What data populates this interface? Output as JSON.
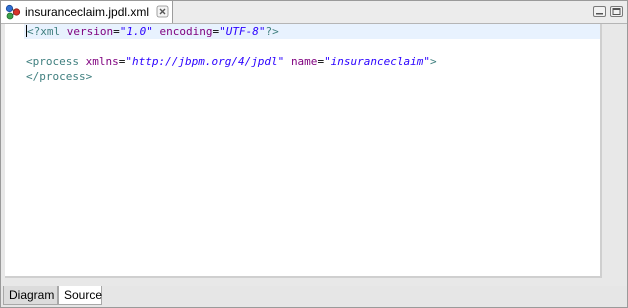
{
  "editor": {
    "tab_title": "insuranceclaim.jpdl.xml",
    "tab_icon": "jpdl-file-icon",
    "close_icon": "close-icon"
  },
  "source": {
    "lines": [
      {
        "parts": [
          {
            "t": "<?xml ",
            "c": "tag"
          },
          {
            "t": "version",
            "c": "attr"
          },
          {
            "t": "=",
            "c": "eq"
          },
          {
            "t": "\"1.0\"",
            "c": "val"
          },
          {
            "t": " ",
            "c": "eq"
          },
          {
            "t": "encoding",
            "c": "attr"
          },
          {
            "t": "=",
            "c": "eq"
          },
          {
            "t": "\"UTF-8\"",
            "c": "val"
          },
          {
            "t": "?>",
            "c": "tag"
          }
        ],
        "current": true
      },
      {
        "parts": [],
        "current": false
      },
      {
        "parts": [
          {
            "t": "<process ",
            "c": "tag"
          },
          {
            "t": "xmlns",
            "c": "attr"
          },
          {
            "t": "=",
            "c": "eq"
          },
          {
            "t": "\"http://jbpm.org/4/jpdl\"",
            "c": "val"
          },
          {
            "t": " ",
            "c": "eq"
          },
          {
            "t": "name",
            "c": "attr"
          },
          {
            "t": "=",
            "c": "eq"
          },
          {
            "t": "\"insuranceclaim\"",
            "c": "val"
          },
          {
            "t": ">",
            "c": "tag"
          }
        ],
        "current": false
      },
      {
        "parts": [
          {
            "t": "</process>",
            "c": "tag"
          }
        ],
        "current": false
      }
    ]
  },
  "bottom_tabs": [
    {
      "label": "Diagram",
      "active": false
    },
    {
      "label": "Source",
      "active": true
    }
  ],
  "colors": {
    "tag": "#3f7f7f",
    "attr": "#7f007f",
    "value": "#2a00ff",
    "current_line": "#e8f2fe"
  }
}
